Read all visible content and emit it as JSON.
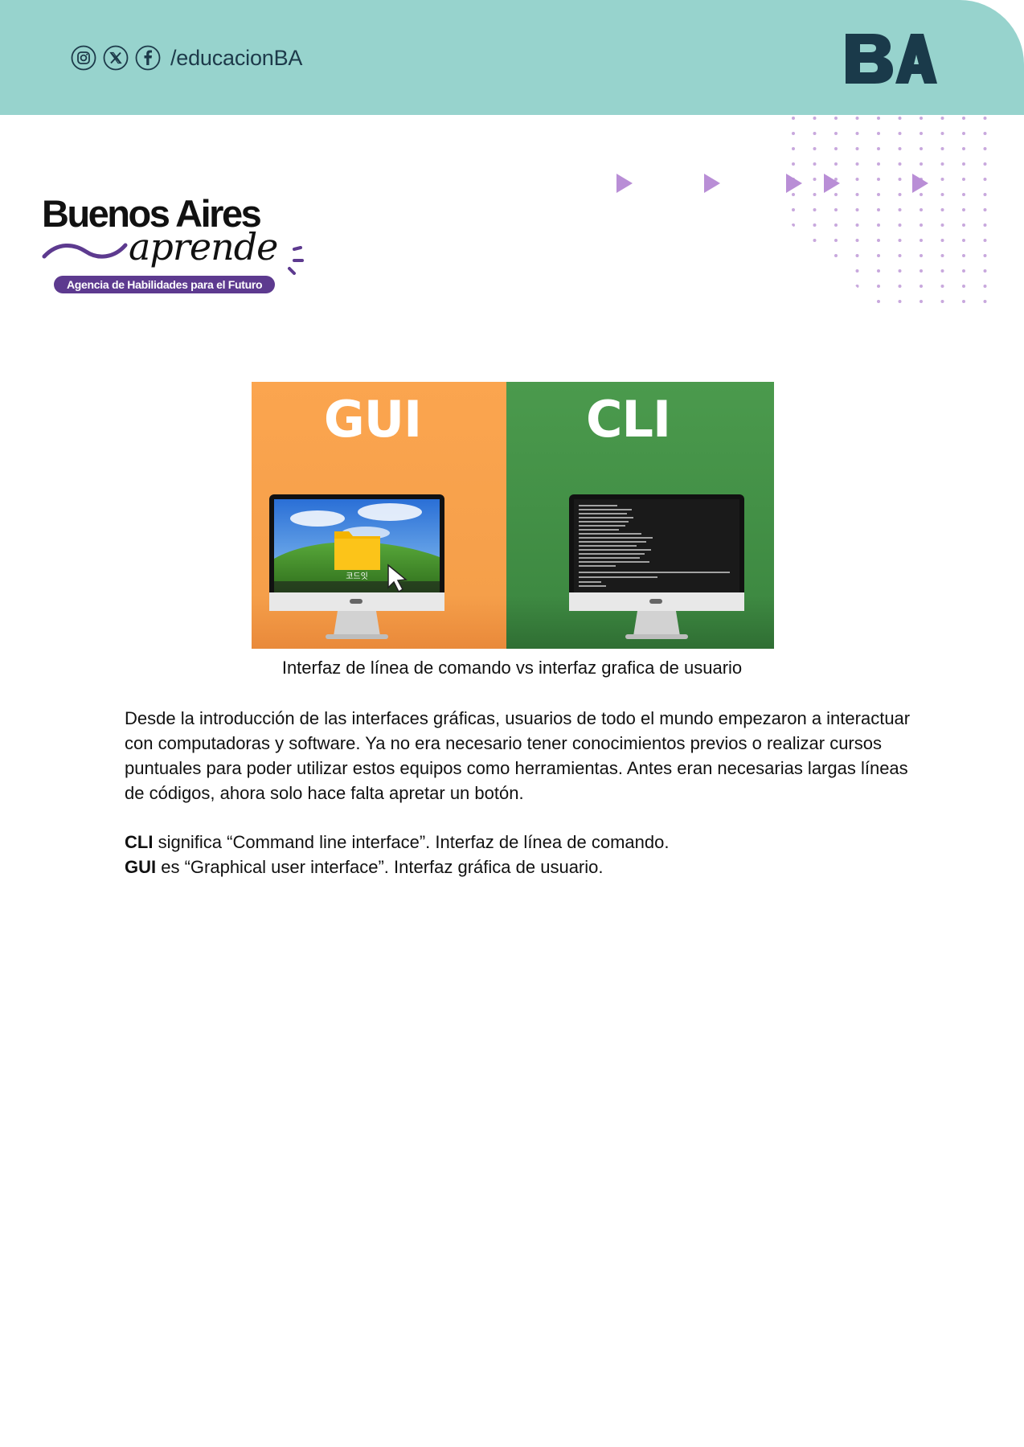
{
  "header": {
    "handle": "/educacionBA",
    "social_icons": [
      "instagram-icon",
      "x-icon",
      "facebook-icon"
    ],
    "logo_text": "BA",
    "background": "#97d3cd"
  },
  "brand": {
    "title": "Buenos Aires",
    "script": "aprende",
    "tagline": "Agencia de Habilidades para el Futuro",
    "accent": "#5d3a8f"
  },
  "figure": {
    "gui_title": "GUI",
    "cli_title": "CLI",
    "folder_label": "코드잇",
    "gui_color": "#f9a24c",
    "cli_color": "#469449"
  },
  "caption": "Interfaz de línea de comando vs interfaz grafica de usuario",
  "paragraph": "Desde la introducción de las interfaces gráficas, usuarios de todo el mundo empezaron a interactuar con computadoras y software. Ya no era necesario tener conocimientos previos o realizar cursos puntuales para poder utilizar estos equipos como herramientas. Antes eran necesarias largas líneas de códigos, ahora solo hace falta apretar un botón.",
  "definitions": [
    {
      "term": "CLI",
      "text": " significa “Command line interface”. Interfaz de línea de comando."
    },
    {
      "term": "GUI",
      "text": " es “Graphical user interface”. Interfaz gráfica de usuario."
    }
  ]
}
